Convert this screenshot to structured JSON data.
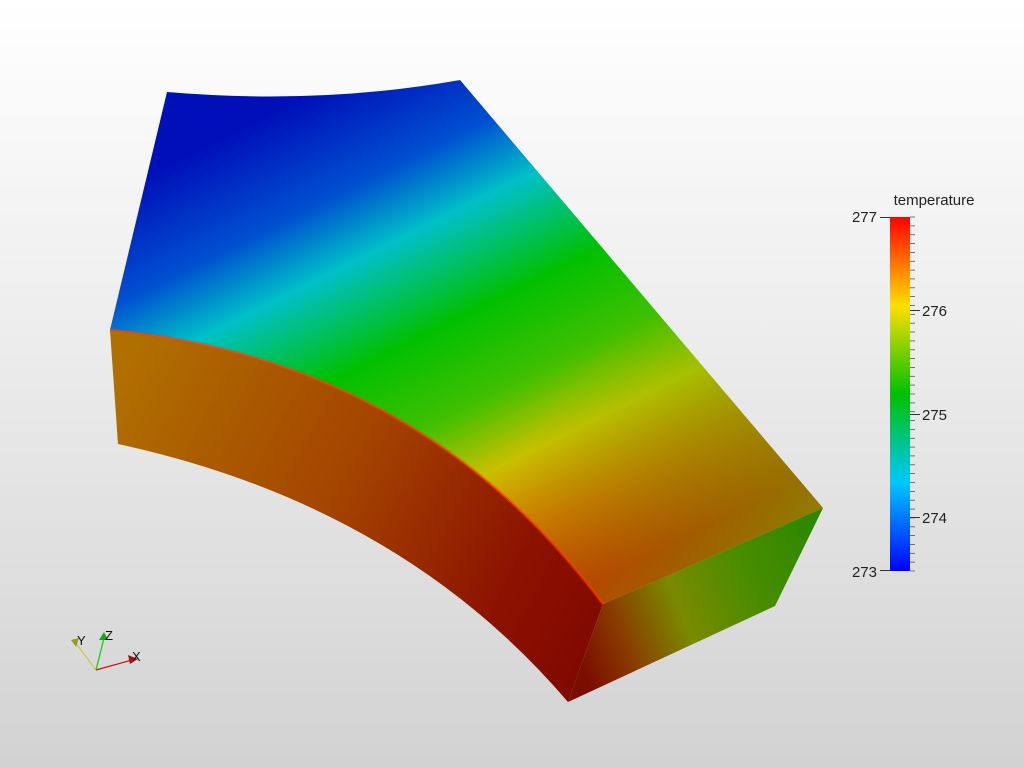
{
  "viewport": {
    "background_top": "#ffffff",
    "background_bottom": "#d2d2d2"
  },
  "scalar_bar": {
    "title": "temperature",
    "min": 273,
    "max": 277,
    "tick_labels": [
      "277",
      "276",
      "275",
      "274",
      "273"
    ],
    "colormap": [
      "#0000ff",
      "#00c8ff",
      "#00c000",
      "#ffe000",
      "#ff0000"
    ]
  },
  "orientation_axes": {
    "x_label": "X",
    "y_label": "Y",
    "z_label": "Z",
    "x_color": "#cc1111",
    "y_color": "#cccc33",
    "z_color": "#11cc11"
  },
  "model": {
    "top_face_colors": [
      "#0018c0",
      "#00c0c8",
      "#00c000",
      "#c8c000",
      "#dd2200"
    ],
    "outer_face_colors": [
      "#b06a00",
      "#8a1000"
    ],
    "end_face_colors": [
      "#7a1a00",
      "#6a8a00",
      "#2e8a00"
    ]
  }
}
